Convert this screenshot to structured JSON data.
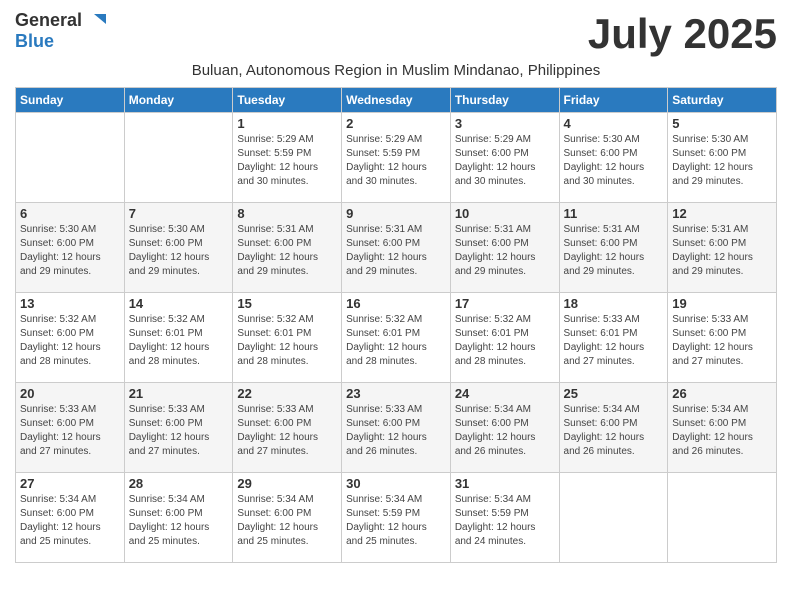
{
  "logo": {
    "line1": "General",
    "line2": "Blue"
  },
  "title": "July 2025",
  "subtitle": "Buluan, Autonomous Region in Muslim Mindanao, Philippines",
  "days_of_week": [
    "Sunday",
    "Monday",
    "Tuesday",
    "Wednesday",
    "Thursday",
    "Friday",
    "Saturday"
  ],
  "weeks": [
    [
      {
        "day": "",
        "info": ""
      },
      {
        "day": "",
        "info": ""
      },
      {
        "day": "1",
        "info": "Sunrise: 5:29 AM\nSunset: 5:59 PM\nDaylight: 12 hours\nand 30 minutes."
      },
      {
        "day": "2",
        "info": "Sunrise: 5:29 AM\nSunset: 5:59 PM\nDaylight: 12 hours\nand 30 minutes."
      },
      {
        "day": "3",
        "info": "Sunrise: 5:29 AM\nSunset: 6:00 PM\nDaylight: 12 hours\nand 30 minutes."
      },
      {
        "day": "4",
        "info": "Sunrise: 5:30 AM\nSunset: 6:00 PM\nDaylight: 12 hours\nand 30 minutes."
      },
      {
        "day": "5",
        "info": "Sunrise: 5:30 AM\nSunset: 6:00 PM\nDaylight: 12 hours\nand 29 minutes."
      }
    ],
    [
      {
        "day": "6",
        "info": "Sunrise: 5:30 AM\nSunset: 6:00 PM\nDaylight: 12 hours\nand 29 minutes."
      },
      {
        "day": "7",
        "info": "Sunrise: 5:30 AM\nSunset: 6:00 PM\nDaylight: 12 hours\nand 29 minutes."
      },
      {
        "day": "8",
        "info": "Sunrise: 5:31 AM\nSunset: 6:00 PM\nDaylight: 12 hours\nand 29 minutes."
      },
      {
        "day": "9",
        "info": "Sunrise: 5:31 AM\nSunset: 6:00 PM\nDaylight: 12 hours\nand 29 minutes."
      },
      {
        "day": "10",
        "info": "Sunrise: 5:31 AM\nSunset: 6:00 PM\nDaylight: 12 hours\nand 29 minutes."
      },
      {
        "day": "11",
        "info": "Sunrise: 5:31 AM\nSunset: 6:00 PM\nDaylight: 12 hours\nand 29 minutes."
      },
      {
        "day": "12",
        "info": "Sunrise: 5:31 AM\nSunset: 6:00 PM\nDaylight: 12 hours\nand 29 minutes."
      }
    ],
    [
      {
        "day": "13",
        "info": "Sunrise: 5:32 AM\nSunset: 6:00 PM\nDaylight: 12 hours\nand 28 minutes."
      },
      {
        "day": "14",
        "info": "Sunrise: 5:32 AM\nSunset: 6:01 PM\nDaylight: 12 hours\nand 28 minutes."
      },
      {
        "day": "15",
        "info": "Sunrise: 5:32 AM\nSunset: 6:01 PM\nDaylight: 12 hours\nand 28 minutes."
      },
      {
        "day": "16",
        "info": "Sunrise: 5:32 AM\nSunset: 6:01 PM\nDaylight: 12 hours\nand 28 minutes."
      },
      {
        "day": "17",
        "info": "Sunrise: 5:32 AM\nSunset: 6:01 PM\nDaylight: 12 hours\nand 28 minutes."
      },
      {
        "day": "18",
        "info": "Sunrise: 5:33 AM\nSunset: 6:01 PM\nDaylight: 12 hours\nand 27 minutes."
      },
      {
        "day": "19",
        "info": "Sunrise: 5:33 AM\nSunset: 6:00 PM\nDaylight: 12 hours\nand 27 minutes."
      }
    ],
    [
      {
        "day": "20",
        "info": "Sunrise: 5:33 AM\nSunset: 6:00 PM\nDaylight: 12 hours\nand 27 minutes."
      },
      {
        "day": "21",
        "info": "Sunrise: 5:33 AM\nSunset: 6:00 PM\nDaylight: 12 hours\nand 27 minutes."
      },
      {
        "day": "22",
        "info": "Sunrise: 5:33 AM\nSunset: 6:00 PM\nDaylight: 12 hours\nand 27 minutes."
      },
      {
        "day": "23",
        "info": "Sunrise: 5:33 AM\nSunset: 6:00 PM\nDaylight: 12 hours\nand 26 minutes."
      },
      {
        "day": "24",
        "info": "Sunrise: 5:34 AM\nSunset: 6:00 PM\nDaylight: 12 hours\nand 26 minutes."
      },
      {
        "day": "25",
        "info": "Sunrise: 5:34 AM\nSunset: 6:00 PM\nDaylight: 12 hours\nand 26 minutes."
      },
      {
        "day": "26",
        "info": "Sunrise: 5:34 AM\nSunset: 6:00 PM\nDaylight: 12 hours\nand 26 minutes."
      }
    ],
    [
      {
        "day": "27",
        "info": "Sunrise: 5:34 AM\nSunset: 6:00 PM\nDaylight: 12 hours\nand 25 minutes."
      },
      {
        "day": "28",
        "info": "Sunrise: 5:34 AM\nSunset: 6:00 PM\nDaylight: 12 hours\nand 25 minutes."
      },
      {
        "day": "29",
        "info": "Sunrise: 5:34 AM\nSunset: 6:00 PM\nDaylight: 12 hours\nand 25 minutes."
      },
      {
        "day": "30",
        "info": "Sunrise: 5:34 AM\nSunset: 5:59 PM\nDaylight: 12 hours\nand 25 minutes."
      },
      {
        "day": "31",
        "info": "Sunrise: 5:34 AM\nSunset: 5:59 PM\nDaylight: 12 hours\nand 24 minutes."
      },
      {
        "day": "",
        "info": ""
      },
      {
        "day": "",
        "info": ""
      }
    ]
  ]
}
